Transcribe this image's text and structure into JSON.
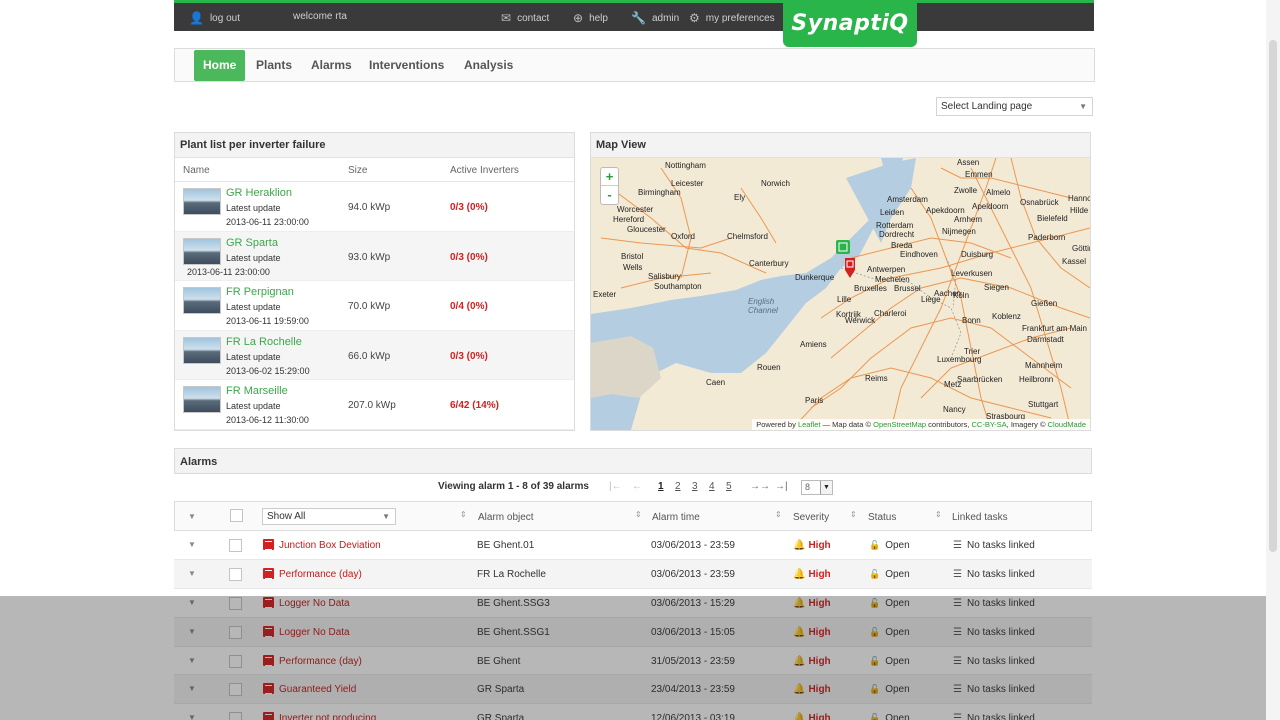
{
  "topbar": {
    "logout": "log out",
    "welcome": "welcome rta",
    "contact": "contact",
    "help": "help",
    "admin": "admin",
    "preferences": "my preferences",
    "logo": "SynaptiQ"
  },
  "nav": {
    "tabs": [
      {
        "label": "Home",
        "active": true
      },
      {
        "label": "Plants",
        "active": false
      },
      {
        "label": "Alarms",
        "active": false
      },
      {
        "label": "Interventions",
        "active": false
      },
      {
        "label": "Analysis",
        "active": false
      }
    ]
  },
  "landing": {
    "label": "Select Landing page"
  },
  "plants": {
    "title": "Plant list per inverter failure",
    "columns": {
      "name": "Name",
      "size": "Size",
      "active": "Active Inverters"
    },
    "latest_label": "Latest update",
    "rows": [
      {
        "name": "GR Heraklion",
        "date": "2013-06-11 23:00:00",
        "size": "94.0 kWp",
        "active": "0/3 (0%)"
      },
      {
        "name": "GR Sparta",
        "date": "2013-06-11 23:00:00",
        "size": "93.0 kWp",
        "active": "0/3 (0%)"
      },
      {
        "name": "FR Perpignan",
        "date": "2013-06-11 19:59:00",
        "size": "70.0 kWp",
        "active": "0/4 (0%)"
      },
      {
        "name": "FR La Rochelle",
        "date": "2013-06-02 15:29:00",
        "size": "66.0 kWp",
        "active": "0/3 (0%)"
      },
      {
        "name": "FR Marseille",
        "date": "2013-06-12 11:30:00",
        "size": "207.0 kWp",
        "active": "6/42 (14%)"
      }
    ]
  },
  "map": {
    "title": "Map View",
    "zoom_in": "+",
    "zoom_out": "-",
    "labels": [
      "Nottingham",
      "Leicester",
      "Norwich",
      "Birmingham",
      "Ely",
      "Worcester",
      "Hereford",
      "Gloucester",
      "Oxford",
      "Chelmsford",
      "Bristol",
      "Wells",
      "Canterbury",
      "Salisbury",
      "Southampton",
      "Dunkerque",
      "Exeter",
      "English Channel",
      "Lille",
      "Amsterdam",
      "Leiden",
      "Rotterdam",
      "Dordrecht",
      "Breda",
      "Eindhoven",
      "Antwerpen",
      "Mechelen",
      "Brussel",
      "Bruxelles",
      "Liège",
      "Charleroi",
      "Aachen",
      "Köln",
      "Bonn",
      "Duisburg",
      "Leverkusen",
      "Siegen",
      "Koblenz",
      "Gießen",
      "Frankfurt am Main",
      "Darmstadt",
      "Mannheim",
      "Heilbronn",
      "Stuttgart",
      "Luxembourg",
      "Trier",
      "Saarbrücken",
      "Metz",
      "Nancy",
      "Strasbourg",
      "Reims",
      "Amiens",
      "Rouen",
      "Caen",
      "Paris",
      "Assen",
      "Emmen",
      "Zwolle",
      "Almelo",
      "Osnabrück",
      "Bielefeld",
      "Paderborn",
      "Kassel",
      "Hanno",
      "Hilde",
      "Göttingen",
      "Nijmegen",
      "Arnhem",
      "Apeldoorn",
      "Apekdoorn",
      "Werwick",
      "Kortrijk"
    ],
    "attribution_pre": "Powered by ",
    "attribution_leaflet": "Leaflet",
    "attribution_mid": " — Map data © ",
    "attribution_osm": "OpenStreetMap",
    "attribution_mid2": " contributors, ",
    "attribution_cc": "CC-BY-SA",
    "attribution_mid3": ", Imagery © ",
    "attribution_cm": "CloudMade"
  },
  "alarms": {
    "title": "Alarms",
    "pager_info": "Viewing alarm 1 - 8 of 39 alarms",
    "pager_first": "|←",
    "pager_prev": "←",
    "pages": [
      "1",
      "2",
      "3",
      "4",
      "5"
    ],
    "pager_next": "→→",
    "pager_last": "→|",
    "page_size": "8",
    "filter": "Show All",
    "columns": {
      "object": "Alarm object",
      "time": "Alarm time",
      "severity": "Severity",
      "status": "Status",
      "linked": "Linked tasks"
    },
    "rows": [
      {
        "type": "Junction Box Deviation",
        "object": "BE Ghent.01",
        "time": "03/06/2013 - 23:59",
        "severity": "High",
        "status": "Open",
        "linked": "No tasks linked"
      },
      {
        "type": "Performance (day)",
        "object": "FR La Rochelle",
        "time": "03/06/2013 - 23:59",
        "severity": "High",
        "status": "Open",
        "linked": "No tasks linked"
      },
      {
        "type": "Logger No Data",
        "object": "BE Ghent.SSG3",
        "time": "03/06/2013 - 15:29",
        "severity": "High",
        "status": "Open",
        "linked": "No tasks linked"
      },
      {
        "type": "Logger No Data",
        "object": "BE Ghent.SSG1",
        "time": "03/06/2013 - 15:05",
        "severity": "High",
        "status": "Open",
        "linked": "No tasks linked"
      },
      {
        "type": "Performance (day)",
        "object": "BE Ghent",
        "time": "31/05/2013 - 23:59",
        "severity": "High",
        "status": "Open",
        "linked": "No tasks linked"
      },
      {
        "type": "Guaranteed Yield",
        "object": "GR Sparta",
        "time": "23/04/2013 - 23:59",
        "severity": "High",
        "status": "Open",
        "linked": "No tasks linked"
      },
      {
        "type": "Inverter not producing",
        "object": "GR Sparta",
        "time": "12/06/2013 - 03:19",
        "severity": "High",
        "status": "Open",
        "linked": "No tasks linked"
      }
    ]
  },
  "colors": {
    "accent": "#2ab54a",
    "alarm": "#d32020",
    "topbar": "#3a3a3a"
  }
}
